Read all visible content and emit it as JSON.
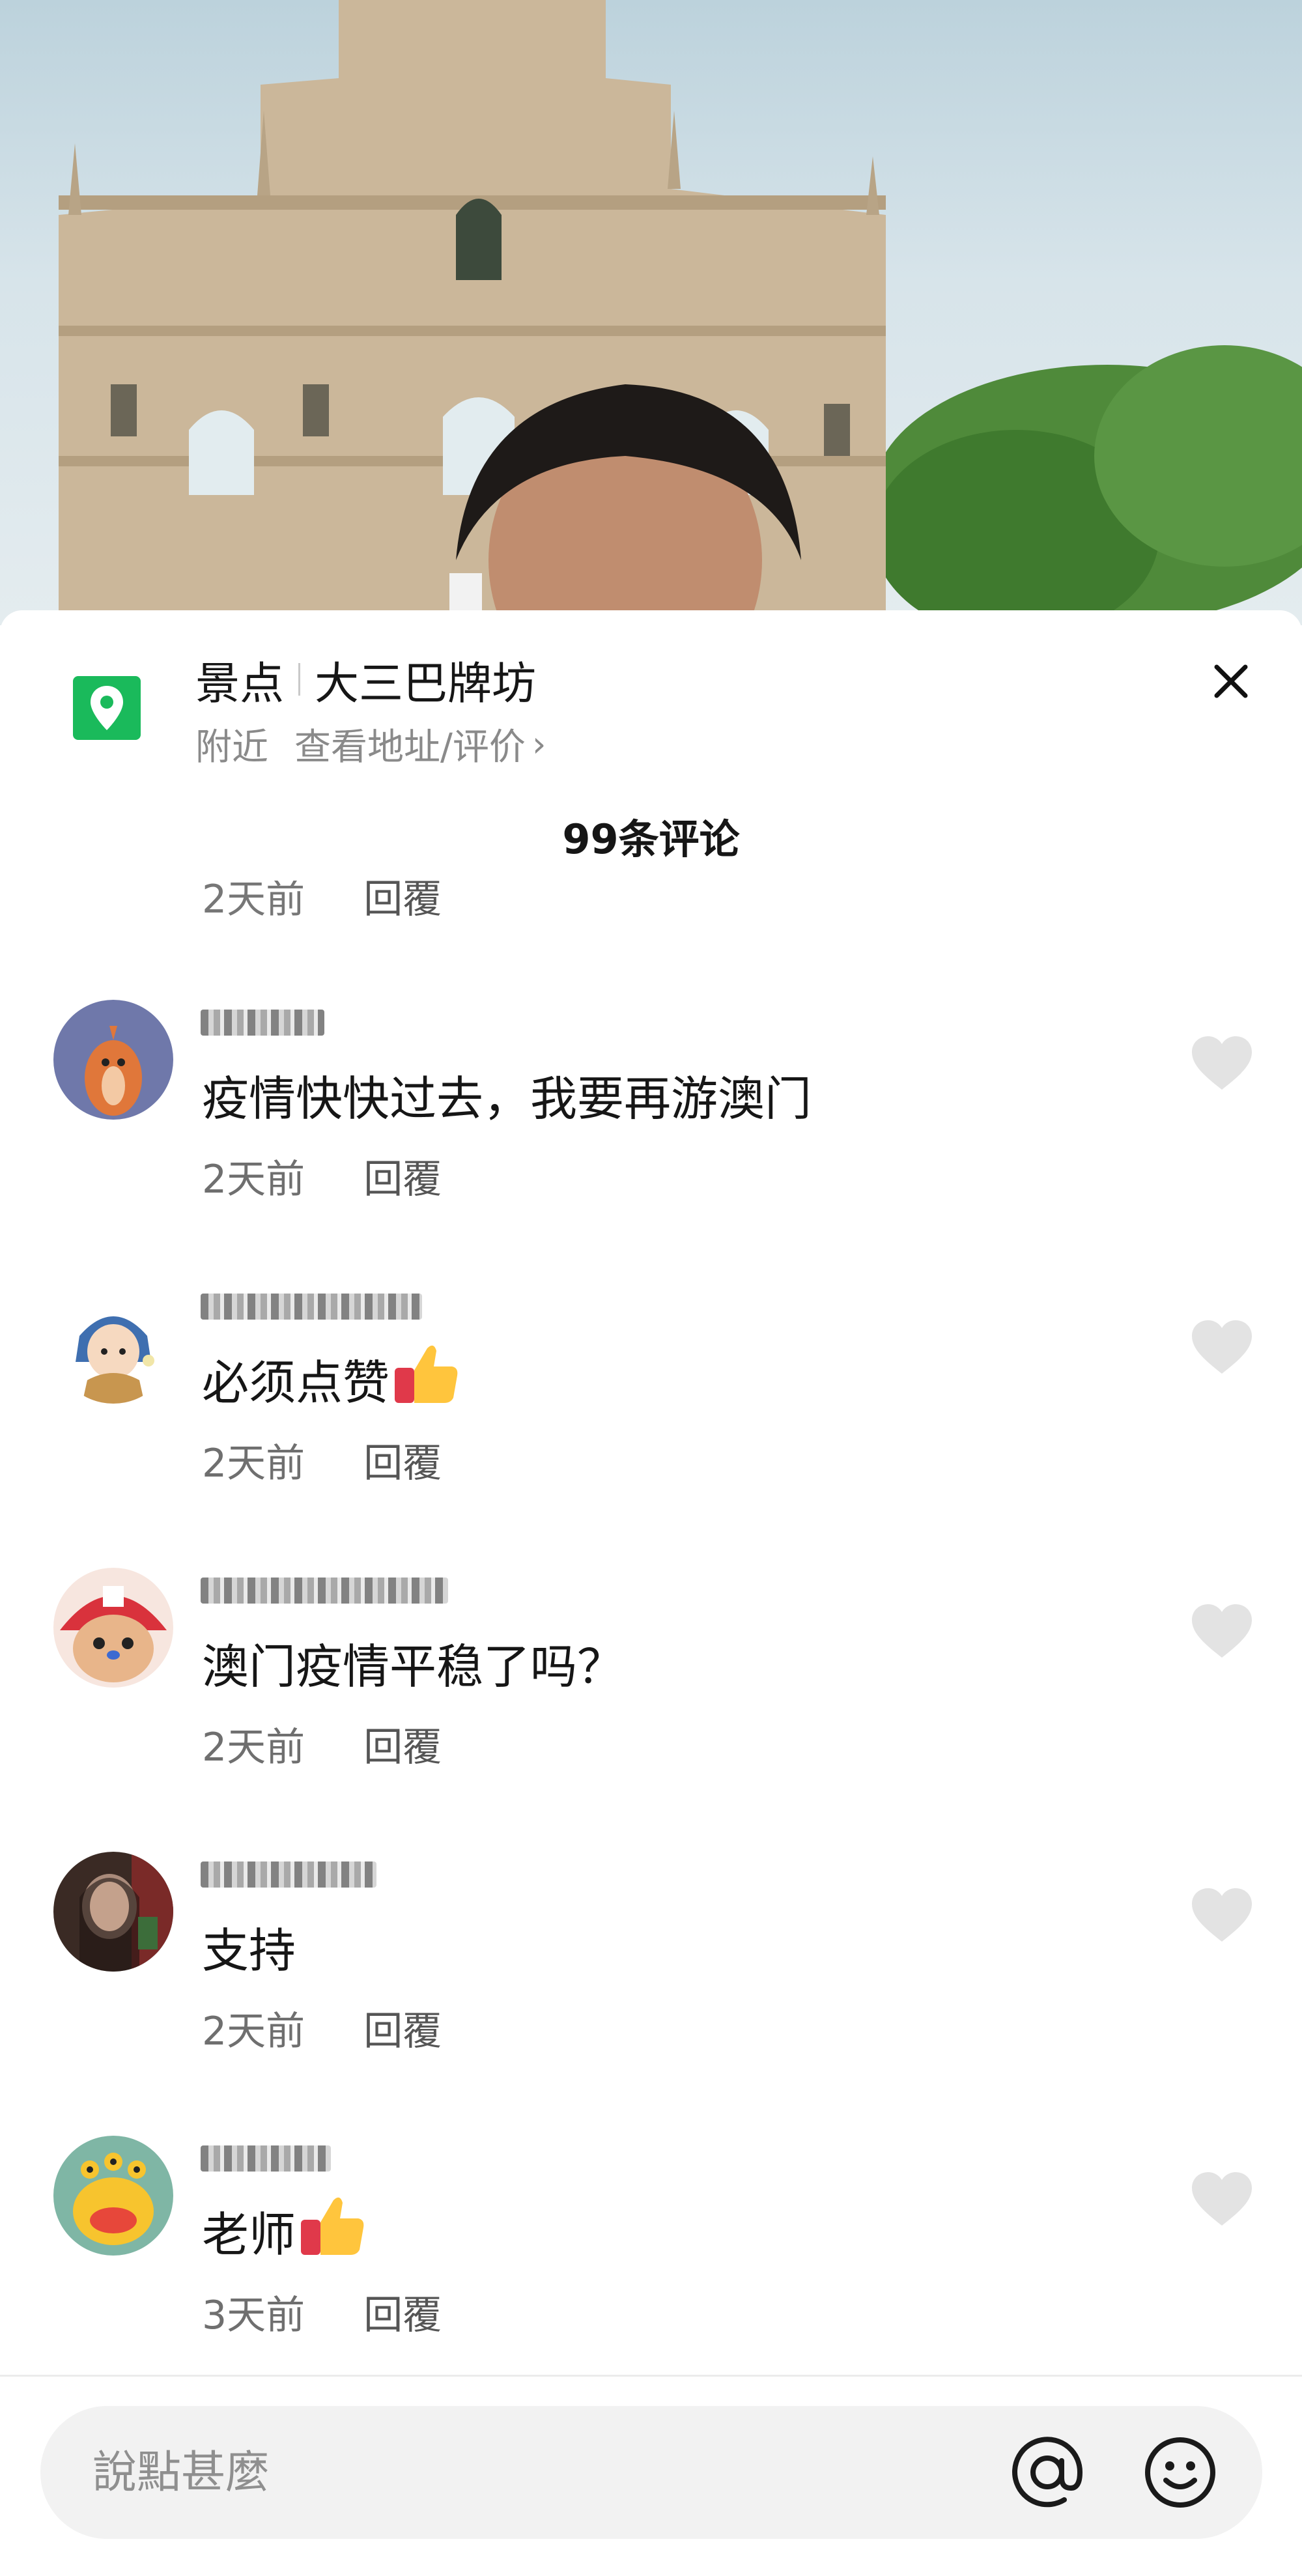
{
  "location": {
    "category": "景点",
    "name": "大三巴牌坊",
    "nearby": "附近",
    "view_link": "查看地址/评价",
    "chevron": "›"
  },
  "comment_count": "99条评论",
  "partial_comment": {
    "time": "2天前",
    "reply": "回覆"
  },
  "comments": [
    {
      "text": "疫情快快过去，我要再游澳门",
      "time": "2天前",
      "reply": "回覆",
      "avatar": "orange-creature-avatar"
    },
    {
      "text": "必须点赞",
      "emoji": "thumbs-up",
      "time": "2天前",
      "reply": "回覆",
      "avatar": "cartoon-girl-avatar"
    },
    {
      "text": "澳门疫情平稳了吗？",
      "time": "2天前",
      "reply": "回覆",
      "avatar": "chopper-avatar"
    },
    {
      "text": "支持",
      "time": "2天前",
      "reply": "回覆",
      "avatar": "photo-avatar"
    },
    {
      "text": "老师",
      "emoji": "thumbs-up",
      "time": "3天前",
      "reply": "回覆",
      "avatar": "yellow-monster-avatar"
    }
  ],
  "input": {
    "placeholder": "說點甚麼"
  },
  "icons": {
    "location": "map-pin-icon",
    "close": "close-icon",
    "like": "heart-icon",
    "mention": "at-icon",
    "emoji": "smiley-icon"
  },
  "colors": {
    "accent_green": "#1aba5b",
    "text_primary": "#161616",
    "text_secondary": "#8a8a8a",
    "heart": "#e3e3e3"
  }
}
